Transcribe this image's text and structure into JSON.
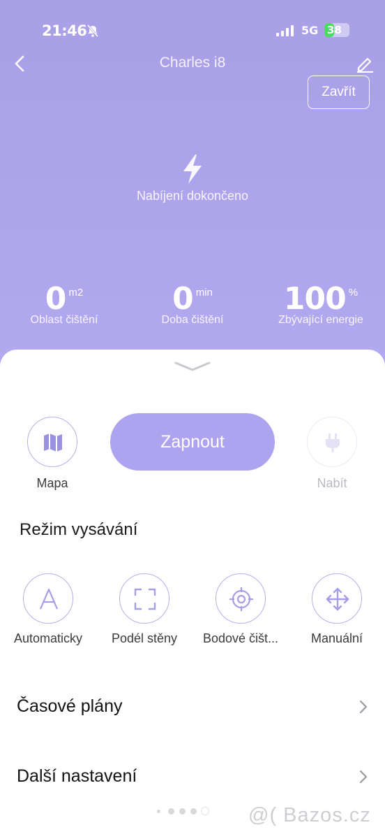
{
  "status_bar": {
    "time": "21:46",
    "network": "5G",
    "battery": "38",
    "battery_level": 0.38
  },
  "header": {
    "title": "Charles i8",
    "close_label": "Zavřít"
  },
  "charging": {
    "text": "Nabíjení dokončeno"
  },
  "stats": [
    {
      "value": "0",
      "unit": "m2",
      "label": "Oblast čištění"
    },
    {
      "value": "0",
      "unit": "min",
      "label": "Doba čištění"
    },
    {
      "value": "100",
      "unit": "%",
      "label": "Zbývající energie"
    }
  ],
  "controls": {
    "map_label": "Mapa",
    "start_label": "Zapnout",
    "charge_label": "Nabít"
  },
  "mode": {
    "title": "Režim vysávání",
    "items": [
      {
        "label": "Automaticky",
        "icon": "letter-a-icon"
      },
      {
        "label": "Podél stěny",
        "icon": "frame-corners-icon"
      },
      {
        "label": "Bodové čišt...",
        "icon": "target-icon"
      },
      {
        "label": "Manuální",
        "icon": "move-arrows-icon"
      }
    ]
  },
  "rows": [
    {
      "label": "Časové plány"
    },
    {
      "label": "Další nastavení"
    }
  ],
  "pager": {
    "count": 5,
    "active": 4
  },
  "watermark": "@( Bazos.cz",
  "colors": {
    "accent": "#ada3ee",
    "header_bg": "#ab a1ea",
    "icon_stroke": "#a59de6"
  }
}
